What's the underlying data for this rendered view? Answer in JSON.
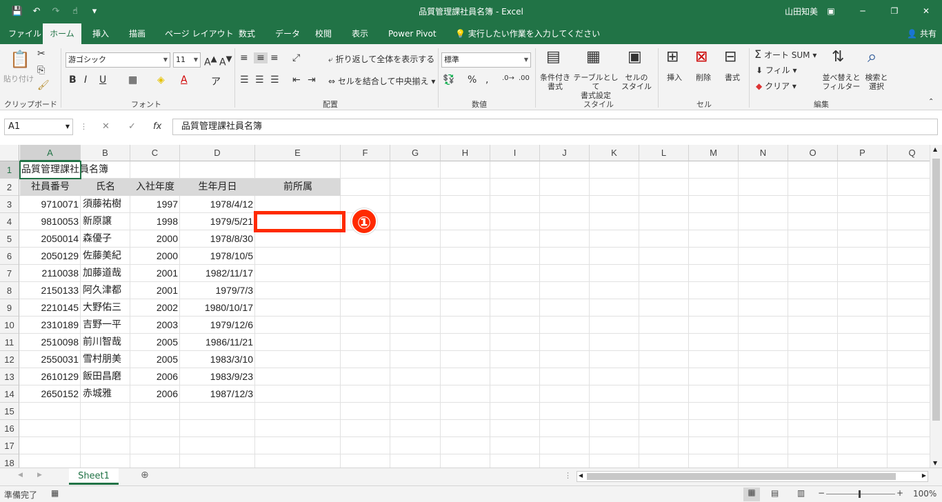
{
  "window": {
    "title": "品質管理課社員名簿  -  Excel",
    "user": "山田知美",
    "qat": {
      "save": "save-icon",
      "undo": "undo-icon",
      "redo": "redo-icon",
      "touch": "touch-mode-icon",
      "customize": "▾"
    }
  },
  "tabs": [
    {
      "label": "ファイル"
    },
    {
      "label": "ホーム"
    },
    {
      "label": "挿入"
    },
    {
      "label": "描画"
    },
    {
      "label": "ページ レイアウト"
    },
    {
      "label": "数式"
    },
    {
      "label": "データ"
    },
    {
      "label": "校閲"
    },
    {
      "label": "表示"
    },
    {
      "label": "Power Pivot"
    }
  ],
  "tell_me": "実行したい作業を入力してください",
  "share": "共有",
  "ribbon": {
    "clipboard": {
      "paste": "貼り付け",
      "label": "クリップボード"
    },
    "font": {
      "name": "游ゴシック",
      "size": "11",
      "label": "フォント",
      "bold": "B",
      "italic": "I",
      "underline": "U"
    },
    "alignment": {
      "wrap": "折り返して全体を表示する",
      "merge": "セルを結合して中央揃え",
      "label": "配置"
    },
    "number": {
      "format": "標準",
      "label": "数値",
      "percent": "%",
      "comma": ","
    },
    "styles": {
      "conditional": "条件付き\n書式",
      "table": "テーブルとして\n書式設定",
      "cell": "セルの\nスタイル",
      "label": "スタイル"
    },
    "cells": {
      "insert": "挿入",
      "delete": "削除",
      "format": "書式",
      "label": "セル"
    },
    "editing": {
      "autosum": "オート SUM",
      "fill": "フィル",
      "clear": "クリア",
      "sort": "並べ替えと\nフィルター",
      "find": "検索と\n選択",
      "label": "編集"
    }
  },
  "formula_bar": {
    "name_box": "A1",
    "fx": "fx",
    "value": "品質管理課社員名簿"
  },
  "columns": [
    "A",
    "B",
    "C",
    "D",
    "E",
    "F",
    "G",
    "H",
    "I",
    "J",
    "K",
    "L",
    "M",
    "N",
    "O",
    "P",
    "Q"
  ],
  "rows": [
    "1",
    "2",
    "3",
    "4",
    "5",
    "6",
    "7",
    "8",
    "9",
    "10",
    "11",
    "12",
    "13",
    "14",
    "15",
    "16",
    "17",
    "18"
  ],
  "sheet_title": "品質管理課社員名簿",
  "headers": [
    "社員番号",
    "氏名",
    "入社年度",
    "生年月日",
    "前所属"
  ],
  "records": [
    [
      "9710071",
      "須藤祐樹",
      "1997",
      "1978/4/12"
    ],
    [
      "9810053",
      "新原譲",
      "1998",
      "1979/5/21"
    ],
    [
      "2050014",
      "森優子",
      "2000",
      "1978/8/30"
    ],
    [
      "2050129",
      "佐藤美紀",
      "2000",
      "1978/10/5"
    ],
    [
      "2110038",
      "加藤道哉",
      "2001",
      "1982/11/17"
    ],
    [
      "2150133",
      "阿久津都",
      "2001",
      "1979/7/3"
    ],
    [
      "2210145",
      "大野佑三",
      "2002",
      "1980/10/17"
    ],
    [
      "2310189",
      "吉野一平",
      "2003",
      "1979/12/6"
    ],
    [
      "2510098",
      "前川智哉",
      "2005",
      "1986/11/21"
    ],
    [
      "2550031",
      "雪村朋美",
      "2005",
      "1983/3/10"
    ],
    [
      "2610129",
      "飯田昌磨",
      "2006",
      "1983/9/23"
    ],
    [
      "2650152",
      "赤城雅",
      "2006",
      "1987/12/3"
    ]
  ],
  "callout_number": "①",
  "sheet_tab": "Sheet1",
  "status": {
    "ready": "準備完了",
    "zoom": "100%"
  },
  "colors": {
    "accent": "#217346",
    "callout": "#ff2a00"
  }
}
